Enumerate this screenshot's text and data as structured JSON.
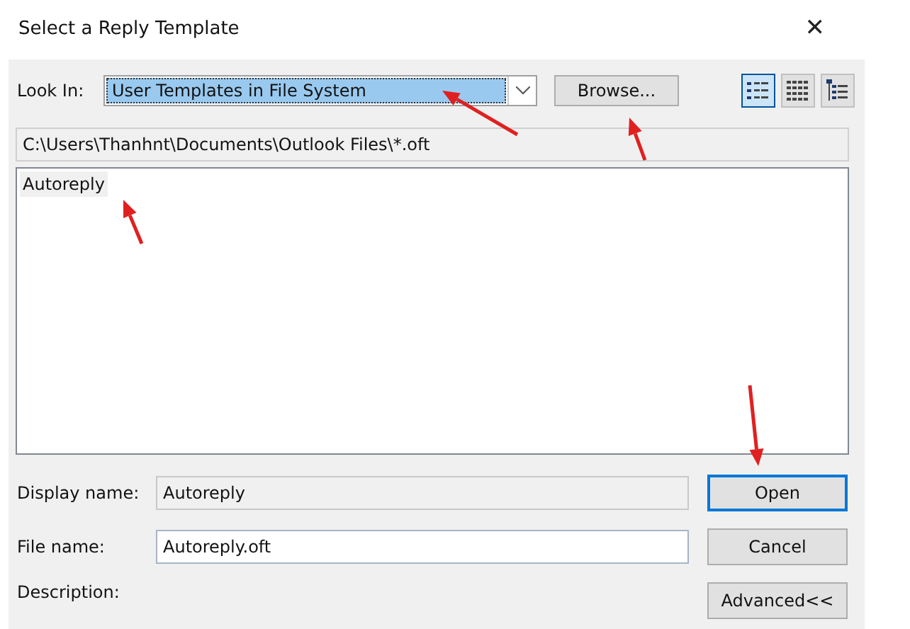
{
  "window": {
    "title": "Select a Reply Template",
    "close": "✕"
  },
  "look_in": {
    "label": "Look In:",
    "value": "User Templates in File System"
  },
  "browse_button": "Browse...",
  "view_buttons": [
    {
      "kind": "list",
      "selected": true
    },
    {
      "kind": "grid",
      "selected": false
    },
    {
      "kind": "tree",
      "selected": false
    }
  ],
  "path": "C:\\Users\\Thanhnt\\Documents\\Outlook Files\\*.oft",
  "files": [
    {
      "name": "Autoreply",
      "selected": true
    }
  ],
  "display_name": {
    "label": "Display name:",
    "value": "Autoreply"
  },
  "file_name": {
    "label": "File name:",
    "value": "Autoreply.oft"
  },
  "description": {
    "label": "Description:"
  },
  "buttons": [
    {
      "label": "Open",
      "default": true
    },
    {
      "label": "Cancel",
      "default": false
    },
    {
      "label": "Advanced<<",
      "default": false
    }
  ],
  "annotations": [
    {
      "kind": "arrow"
    },
    {
      "kind": "arrow"
    },
    {
      "kind": "arrow"
    },
    {
      "kind": "arrow"
    }
  ]
}
